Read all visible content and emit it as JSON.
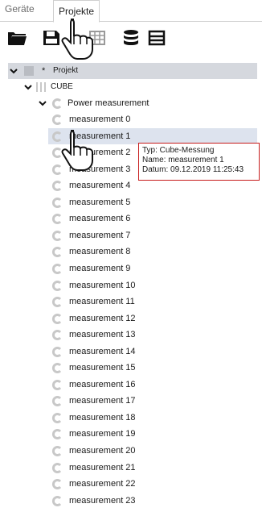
{
  "tabs": [
    {
      "label": "Geräte",
      "active": false
    },
    {
      "label": "Projekte",
      "active": true
    }
  ],
  "toolbar": {
    "icons": [
      "folder-open-icon",
      "save-icon",
      "calculator-icon",
      "database-icon",
      "list-icon"
    ]
  },
  "tree": {
    "root": {
      "label": "Projekt",
      "modified_marker": "*",
      "expanded": true
    },
    "group": {
      "label": "CUBE",
      "expanded": true
    },
    "parent": {
      "label": "Power measurement",
      "expanded": true
    },
    "items": [
      "measurement 0",
      "measurement 1",
      "measurement 2",
      "measurement 3",
      "measurement 4",
      "measurement 5",
      "measurement 6",
      "measurement 7",
      "measurement 8",
      "measurement 9",
      "measurement 10",
      "measurement 11",
      "measurement 12",
      "measurement 13",
      "measurement 14",
      "measurement 15",
      "measurement 16",
      "measurement 17",
      "measurement 18",
      "measurement 19",
      "measurement 20",
      "measurement 21",
      "measurement 22",
      "measurement 23"
    ],
    "selected_item": "measurement 1"
  },
  "tooltip": {
    "type_line": "Typ: Cube-Messung",
    "name_line": "Name: measurement 1",
    "date_line": "Datum: 09.12.2019 11:25:43"
  },
  "colors": {
    "header_row": "#d5d8de",
    "selected_row": "#dde3ee",
    "tooltip_border": "#c61b1b",
    "icon_gray": "#c8c8c8"
  }
}
